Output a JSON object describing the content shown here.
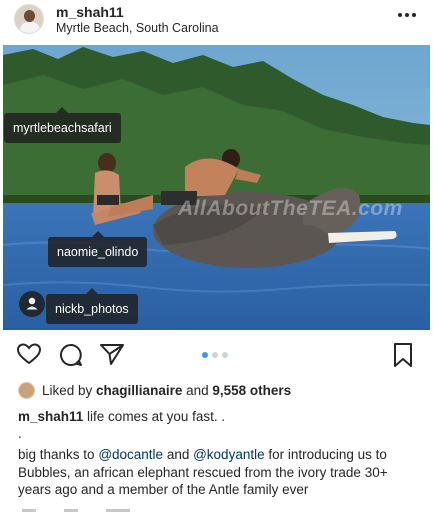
{
  "post": {
    "username": "m_shah11",
    "location": "Myrtle Beach, South Carolina"
  },
  "photo": {
    "watermark": "AllAboutTheTEA.com",
    "tags": [
      {
        "label": "myrtlebeachsafari"
      },
      {
        "label": "naomie_olindo"
      },
      {
        "label": "nickb_photos"
      }
    ]
  },
  "carousel": {
    "total": 3,
    "active_index": 0
  },
  "likes": {
    "prefix": "Liked by ",
    "user": "chagillianaire",
    "middle": " and ",
    "count": "9,558 others"
  },
  "caption": {
    "username": "m_shah11",
    "text": " life comes at you fast. .",
    "dot": ".",
    "body_1": "big thanks to ",
    "mention_1": "@docantle",
    "body_2": " and ",
    "mention_2": "@kodyantle",
    "body_3": " for introducing us to Bubbles, an african elephant rescued from the ivory trade 30+ years ago and a member of the Antle family ever"
  },
  "colors": {
    "accent": "#3897f0",
    "text": "#262626",
    "mention": "#003569",
    "tag_bg": "#1e1e1e"
  },
  "icons": {
    "more": "more-horizontal-icon",
    "like": "heart-icon",
    "comment": "comment-icon",
    "share": "send-icon",
    "save": "bookmark-icon",
    "tag": "person-icon"
  }
}
